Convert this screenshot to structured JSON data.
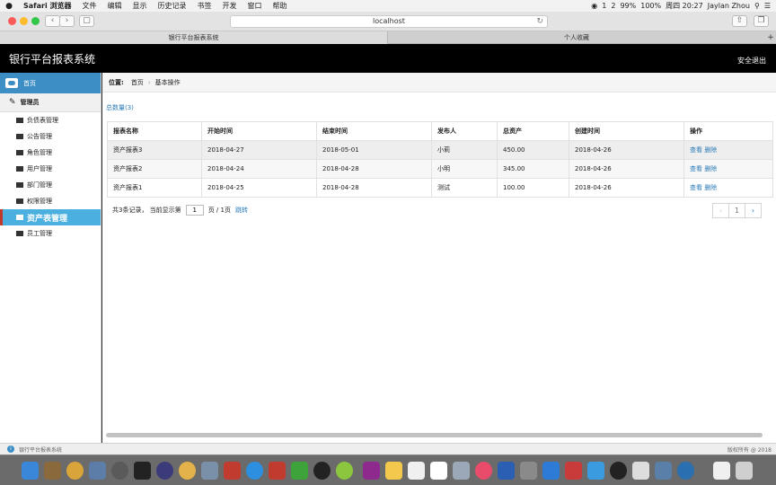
{
  "os": {
    "apple": "",
    "menus": [
      "Safari 浏览器",
      "文件",
      "编辑",
      "显示",
      "历史记录",
      "书签",
      "开发",
      "窗口",
      "帮助"
    ],
    "status": [
      "1",
      "2",
      "99%",
      "100%",
      "周四 20:27",
      "Jaylan Zhou"
    ]
  },
  "browser": {
    "address": "localhost",
    "tabs": [
      "银行平台报表系统",
      "个人收藏"
    ]
  },
  "app": {
    "title": "银行平台报表系统",
    "logout": "安全退出"
  },
  "sidebar": {
    "home": "首页",
    "group": "管理员",
    "items": [
      {
        "label": "负债表管理"
      },
      {
        "label": "公告管理"
      },
      {
        "label": "角色管理"
      },
      {
        "label": "用户管理"
      },
      {
        "label": "部门管理"
      },
      {
        "label": "权限管理"
      },
      {
        "label": "资产表管理"
      },
      {
        "label": "员工管理"
      }
    ]
  },
  "breadcrumb": {
    "label": "位置:",
    "home": "首页",
    "current": "基本操作"
  },
  "total": "总数量(3)",
  "table": {
    "headers": [
      "报表名称",
      "开始时间",
      "结束时间",
      "发布人",
      "总资产",
      "创建时间",
      "操作"
    ],
    "rows": [
      {
        "name": "资产报表3",
        "start": "2018-04-27",
        "end": "2018-05-01",
        "publisher": "小莉",
        "assets": "450.00",
        "created": "2018-04-26",
        "view": "查看",
        "del": "删除"
      },
      {
        "name": "资产报表2",
        "start": "2018-04-24",
        "end": "2018-04-28",
        "publisher": "小明",
        "assets": "345.00",
        "created": "2018-04-26",
        "view": "查看",
        "del": "删除"
      },
      {
        "name": "资产报表1",
        "start": "2018-04-25",
        "end": "2018-04-28",
        "publisher": "测试",
        "assets": "100.00",
        "created": "2018-04-26",
        "view": "查看",
        "del": "删除"
      }
    ]
  },
  "pager": {
    "prefix": "共3条记录，  当前显示第",
    "current": "1",
    "suffix": "页 / 1页",
    "go": "跳转",
    "page": "1",
    "prev": "‹",
    "next": "›"
  },
  "footer": {
    "text": "银行平台报表系统",
    "copyright": "版权所有 @ 2018"
  },
  "colors": {
    "accent": "#3d8ec4",
    "active": "#4bb0e0",
    "header": "#000000"
  }
}
